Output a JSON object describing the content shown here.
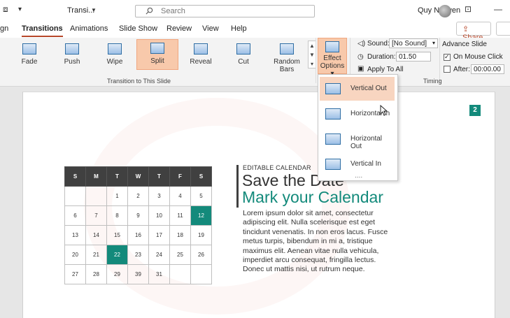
{
  "titlebar": {
    "doc_title": "Transi...",
    "search_placeholder": "Search",
    "user_name": "Quy Nguyen"
  },
  "tabs": [
    {
      "label": "gn"
    },
    {
      "label": "Transitions"
    },
    {
      "label": "Animations"
    },
    {
      "label": "Slide Show"
    },
    {
      "label": "Review"
    },
    {
      "label": "View"
    },
    {
      "label": "Help"
    }
  ],
  "share_label": "Share",
  "transitions": [
    {
      "label": "Fade"
    },
    {
      "label": "Push"
    },
    {
      "label": "Wipe"
    },
    {
      "label": "Split"
    },
    {
      "label": "Reveal"
    },
    {
      "label": "Cut"
    },
    {
      "label": "Random Bars"
    }
  ],
  "effect_options": {
    "line1": "Effect",
    "line2": "Options"
  },
  "timing": {
    "sound_label": "Sound:",
    "sound_value": "[No Sound]",
    "duration_label": "Duration:",
    "duration_value": "01.50",
    "apply_all": "Apply To All",
    "advance_label": "Advance Slide",
    "on_click": "On Mouse Click",
    "after_label": "After:",
    "after_value": "00:00.00"
  },
  "group_labels": {
    "transition": "Transition to This Slide",
    "timing": "Timing"
  },
  "dropdown": {
    "items": [
      {
        "label": "Vertical Out"
      },
      {
        "label": "Horizontal In"
      },
      {
        "label": "Horizontal Out"
      },
      {
        "label": "Vertical In"
      }
    ],
    "more": "...."
  },
  "slide": {
    "badge": "2",
    "eyebrow": "EDITABLE CALENDAR",
    "heading": "Save the Date",
    "subheading": "Mark your Calendar",
    "body": "Lorem ipsum dolor sit amet, consectetur adipiscing elit. Nulla scelerisque est eget tincidunt venenatis. In non eros lacus. Fusce metus turpis, bibendum in mi a, tristique maximus elit. Aenean vitae nulla vehicula, imperdiet arcu consequat, fringilla lectus. Donec ut mattis nisi, ut rutrum neque.",
    "calendar": {
      "days": [
        "S",
        "M",
        "T",
        "W",
        "T",
        "F",
        "S"
      ],
      "rows": [
        [
          "",
          "",
          "1",
          "2",
          "3",
          "4",
          "5"
        ],
        [
          "6",
          "7",
          "8",
          "9",
          "10",
          "11",
          "12"
        ],
        [
          "13",
          "14",
          "15",
          "16",
          "17",
          "18",
          "19"
        ],
        [
          "20",
          "21",
          "22",
          "23",
          "24",
          "25",
          "26"
        ],
        [
          "27",
          "28",
          "29",
          "39",
          "31",
          "",
          ""
        ]
      ]
    }
  },
  "colors": {
    "accent": "#138a7b",
    "ribbon_selected": "#f8c9ab",
    "tab_underline": "#b7472a"
  }
}
